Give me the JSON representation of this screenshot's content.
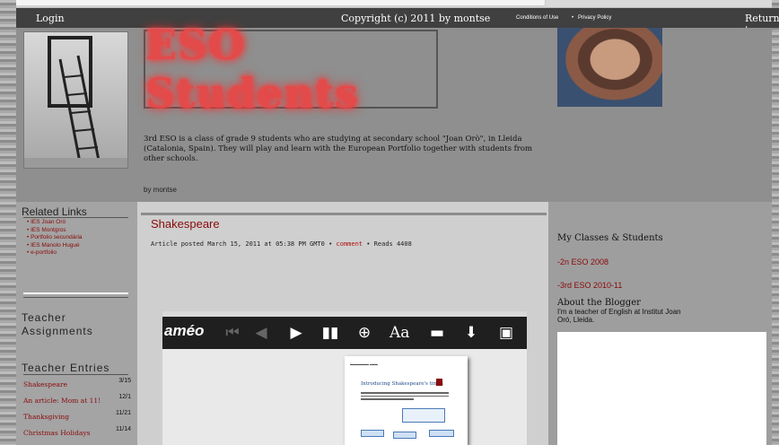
{
  "topbar": {
    "login": "Login",
    "copyright": "Copyright (c) 2011 by montse",
    "conditions": "Conditions of Use",
    "privacy": "Privacy Policy",
    "return": "Return t"
  },
  "header": {
    "logo_text": "ESO Students",
    "intro": "3rd ESO is a class of grade 9 students who are studying at secondary school \"Joan Orò\", in Lleida (Catalonia, Spain). They will play and learn with the European Portfolio together with students from other schools.",
    "byline": "by montse"
  },
  "sidebar": {
    "related_title": "Related Links",
    "links": [
      "IES Joan Orò",
      "IES Montgros",
      "Portfolio secundària",
      "IES Manolo Hugué",
      "e-portfolio"
    ],
    "assign_title": "Teacher Assignments",
    "entries_title": "Teacher Entries",
    "entries": [
      {
        "title": "Shakespeare",
        "date": "3/15"
      },
      {
        "title": "An article: Mom at 11!",
        "date": "12/1"
      },
      {
        "title": "Thanksgiving",
        "date": "11/21"
      },
      {
        "title": "Christmas Holidays",
        "date": "11/14"
      }
    ]
  },
  "article": {
    "title": "Shakespeare",
    "posted": "Article posted March 15, 2011 at 05:38 PM GMT0 •",
    "comment": "comment",
    "reads": "• Reads 4408"
  },
  "viewer": {
    "brand": "améo",
    "doc_title": "Introducing Shakespeare's times"
  },
  "right": {
    "classes_title": "My Classes & Students",
    "class1": "-2n ESO 2008",
    "class2": "-3rd ESO 2010-11",
    "about_title": "About the Blogger",
    "about_text": "I'm a teacher of English at Institut Joan Oró, Lleida."
  }
}
